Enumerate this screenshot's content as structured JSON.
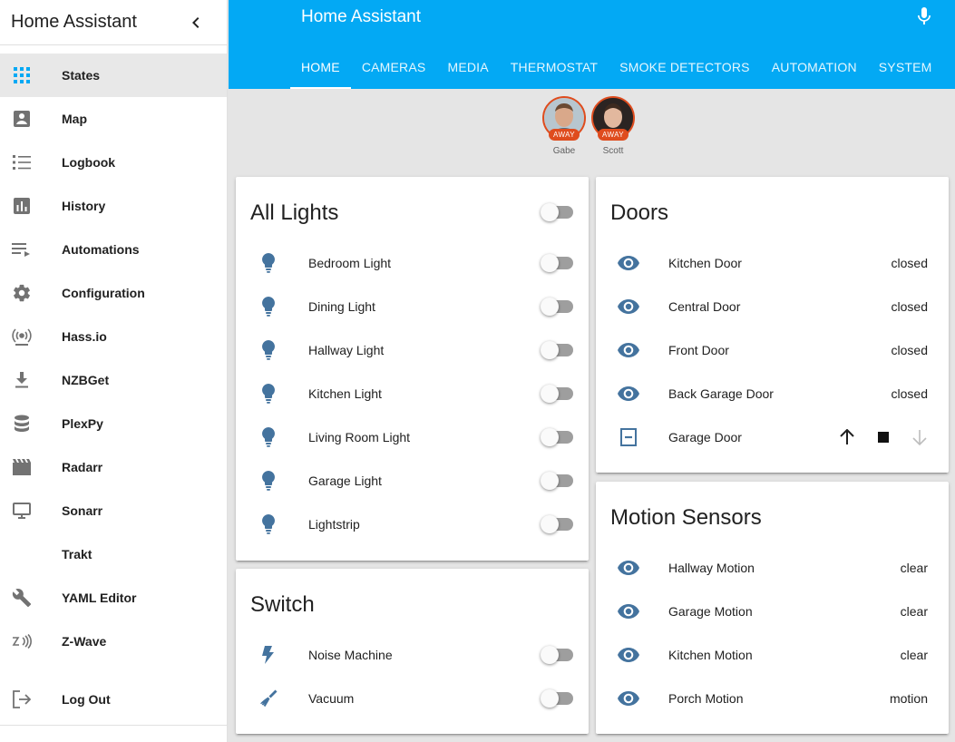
{
  "sidebar": {
    "title": "Home Assistant",
    "items": [
      {
        "label": "States",
        "icon": "grid-icon"
      },
      {
        "label": "Map",
        "icon": "map-icon"
      },
      {
        "label": "Logbook",
        "icon": "logbook-icon"
      },
      {
        "label": "History",
        "icon": "history-icon"
      },
      {
        "label": "Automations",
        "icon": "automations-icon"
      },
      {
        "label": "Configuration",
        "icon": "gear-icon"
      },
      {
        "label": "Hass.io",
        "icon": "hassio-icon"
      },
      {
        "label": "NZBGet",
        "icon": "download-icon"
      },
      {
        "label": "PlexPy",
        "icon": "database-icon"
      },
      {
        "label": "Radarr",
        "icon": "film-icon"
      },
      {
        "label": "Sonarr",
        "icon": "monitor-icon"
      },
      {
        "label": "Trakt",
        "icon": ""
      },
      {
        "label": "YAML Editor",
        "icon": "wrench-icon"
      },
      {
        "label": "Z-Wave",
        "icon": "zwave-icon"
      }
    ],
    "logout": "Log Out"
  },
  "header": {
    "title": "Home Assistant",
    "tabs": [
      "HOME",
      "CAMERAS",
      "MEDIA",
      "THERMOSTAT",
      "SMOKE DETECTORS",
      "AUTOMATION",
      "SYSTEM"
    ]
  },
  "badges": [
    {
      "name": "Gabe",
      "state": "AWAY"
    },
    {
      "name": "Scott",
      "state": "AWAY"
    }
  ],
  "cards": {
    "all_lights": {
      "title": "All Lights",
      "rows": [
        "Bedroom Light",
        "Dining Light",
        "Hallway Light",
        "Kitchen Light",
        "Living Room Light",
        "Garage Light",
        "Lightstrip"
      ]
    },
    "switch": {
      "title": "Switch",
      "rows": [
        "Noise Machine",
        "Vacuum"
      ]
    },
    "doors": {
      "title": "Doors",
      "rows": [
        {
          "name": "Kitchen Door",
          "state": "closed"
        },
        {
          "name": "Central Door",
          "state": "closed"
        },
        {
          "name": "Front Door",
          "state": "closed"
        },
        {
          "name": "Back Garage Door",
          "state": "closed"
        }
      ],
      "garage": {
        "name": "Garage Door"
      }
    },
    "motion": {
      "title": "Motion Sensors",
      "rows": [
        {
          "name": "Hallway Motion",
          "state": "clear"
        },
        {
          "name": "Garage Motion",
          "state": "clear"
        },
        {
          "name": "Kitchen Motion",
          "state": "clear"
        },
        {
          "name": "Porch Motion",
          "state": "motion"
        }
      ]
    }
  },
  "colors": {
    "primary": "#03a9f4",
    "icon": "#44739e",
    "away": "#df4c1e"
  }
}
